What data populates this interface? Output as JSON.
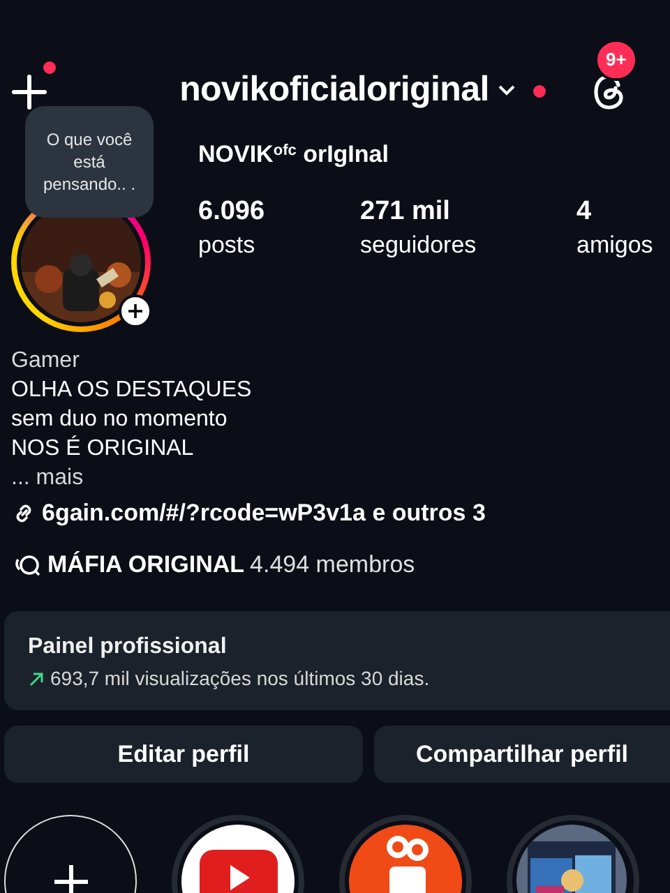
{
  "header": {
    "username": "novikoficialoriginal",
    "create_dot": true,
    "account_dot": true,
    "threads_badge": "9+"
  },
  "profile": {
    "note": "O que você está pensando.. .",
    "display_name": "NOVIK$^{ofc}$ orIgInal",
    "stats": [
      {
        "value": "6.096",
        "label": "posts"
      },
      {
        "value": "271 mil",
        "label": "seguidores"
      },
      {
        "value": "4",
        "label": "amigos"
      }
    ]
  },
  "bio": {
    "category": "Gamer",
    "lines": [
      "OLHA OS DESTAQUES",
      "sem duo no momento",
      "NOS É ORIGINAL"
    ],
    "more": "... mais",
    "link": "6gain.com/#/?rcode=wP3v1a e outros 3",
    "community": {
      "name": "MÁFIA ORIGINAL",
      "members": "4.494 membros"
    }
  },
  "dashboard": {
    "title": "Painel profissional",
    "stat": "693,7 mil visualizações nos últimos 30 dias."
  },
  "buttons": [
    "Editar perfil",
    "Compartilhar perfil"
  ],
  "highlights": [
    {
      "kind": "new"
    },
    {
      "kind": "youtube"
    },
    {
      "kind": "kwai"
    },
    {
      "kind": "picture"
    }
  ]
}
